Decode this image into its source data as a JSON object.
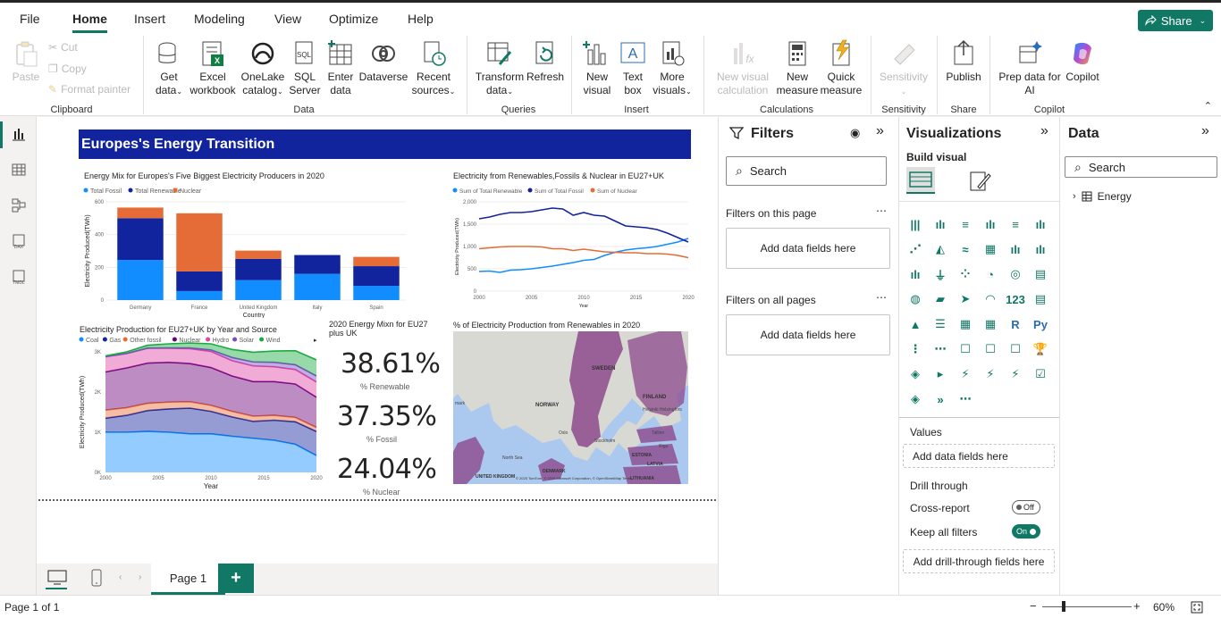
{
  "menu": [
    "File",
    "Home",
    "Insert",
    "Modeling",
    "View",
    "Optimize",
    "Help"
  ],
  "share_label": "Share",
  "ribbon": {
    "clipboard": {
      "paste": "Paste",
      "cut": "Cut",
      "copy": "Copy",
      "format_painter": "Format painter",
      "group": "Clipboard"
    },
    "data": {
      "get_data": "Get data",
      "excel": "Excel workbook",
      "onelake": "OneLake catalog",
      "sql": "SQL Server",
      "enter_data": "Enter data",
      "dataverse": "Dataverse",
      "recent": "Recent sources",
      "group": "Data"
    },
    "queries": {
      "transform": "Transform data",
      "refresh": "Refresh",
      "group": "Queries"
    },
    "insert": {
      "new_visual": "New visual",
      "text_box": "Text box",
      "more_visuals": "More visuals",
      "group": "Insert"
    },
    "calculations": {
      "new_visual_calc": "New visual calculation",
      "new_measure": "New measure",
      "quick_measure": "Quick measure",
      "group": "Calculations"
    },
    "sensitivity": {
      "label": "Sensitivity",
      "group": "Sensitivity"
    },
    "share": {
      "publish": "Publish",
      "group": "Share"
    },
    "copilot": {
      "prep": "Prep data for AI",
      "copilot": "Copilot",
      "group": "Copilot"
    }
  },
  "report": {
    "title": "Europes's Energy Transition",
    "colors": {
      "fossil": "#118dff",
      "renewable": "#12239e",
      "nuclear": "#e66c37",
      "banner": "#12239e"
    }
  },
  "chart_data": [
    {
      "type": "bar",
      "title": "Energy Mix for Europes's Five Biggest Electricity Producers in 2020",
      "xlabel": "Country",
      "ylabel": "Electricity Produced(TWh)",
      "ylim": [
        0,
        600
      ],
      "yticks": [
        "0",
        "200",
        "400",
        "600"
      ],
      "categories": [
        "Germany",
        "France",
        "United Kingdom",
        "Italy",
        "Spain"
      ],
      "series": [
        {
          "name": "Total Fossil",
          "values": [
            245,
            55,
            122,
            160,
            87
          ]
        },
        {
          "name": "Total Renewable",
          "values": [
            255,
            120,
            130,
            115,
            120
          ]
        },
        {
          "name": "Nuclear",
          "values": [
            65,
            355,
            50,
            0,
            57
          ]
        }
      ]
    },
    {
      "type": "line",
      "title": "Electricity from Renewables,Fossils & Nuclear in EU27+UK",
      "xlabel": "Year",
      "ylabel": "Electricity Produced(TWh)",
      "ylim": [
        0,
        2000
      ],
      "yticks": [
        "0",
        "500",
        "1,000",
        "1,500",
        "2,000"
      ],
      "xticks": [
        "2000",
        "2005",
        "2010",
        "2015",
        "2020"
      ],
      "x": [
        2000,
        2001,
        2002,
        2003,
        2004,
        2005,
        2006,
        2007,
        2008,
        2009,
        2010,
        2011,
        2012,
        2013,
        2014,
        2015,
        2016,
        2017,
        2018,
        2019,
        2020
      ],
      "series": [
        {
          "name": "Sum of Total Renewable",
          "values": [
            440,
            450,
            420,
            470,
            480,
            500,
            530,
            560,
            600,
            640,
            690,
            710,
            800,
            870,
            920,
            950,
            970,
            1000,
            1050,
            1100,
            1180
          ]
        },
        {
          "name": "Sum of Total Fossil",
          "values": [
            1620,
            1660,
            1720,
            1760,
            1760,
            1780,
            1820,
            1860,
            1840,
            1700,
            1760,
            1700,
            1680,
            1570,
            1460,
            1440,
            1420,
            1380,
            1300,
            1200,
            1100
          ]
        },
        {
          "name": "Sum of Nuclear",
          "values": [
            950,
            970,
            990,
            1000,
            1000,
            1000,
            990,
            950,
            950,
            910,
            940,
            910,
            880,
            870,
            860,
            860,
            840,
            840,
            830,
            800,
            750
          ]
        }
      ]
    },
    {
      "type": "area",
      "title": "Electricity Production for EU27+UK by Year and Source",
      "xlabel": "Year",
      "ylabel": "Electricity Produced(TWh)",
      "ylim": [
        0,
        3000
      ],
      "yticks": [
        "0K",
        "1K",
        "2K",
        "3K"
      ],
      "xticks": [
        "2000",
        "2005",
        "2010",
        "2015",
        "2020"
      ],
      "x": [
        2000,
        2002,
        2004,
        2006,
        2008,
        2010,
        2012,
        2014,
        2016,
        2018,
        2020
      ],
      "series": [
        {
          "name": "Coal",
          "values": [
            1000,
            1000,
            1020,
            1000,
            960,
            960,
            900,
            850,
            800,
            700,
            420
          ]
        },
        {
          "name": "Gas",
          "values": [
            350,
            420,
            520,
            580,
            640,
            560,
            480,
            420,
            500,
            560,
            600
          ]
        },
        {
          "name": "Other fossil",
          "values": [
            200,
            190,
            180,
            170,
            160,
            150,
            140,
            130,
            120,
            110,
            100
          ]
        },
        {
          "name": "Nuclear",
          "values": [
            950,
            990,
            1000,
            990,
            950,
            940,
            880,
            860,
            840,
            830,
            750
          ]
        },
        {
          "name": "Hydro",
          "values": [
            380,
            360,
            370,
            350,
            370,
            400,
            380,
            390,
            370,
            360,
            380
          ]
        },
        {
          "name": "Solar",
          "values": [
            0,
            0,
            5,
            10,
            20,
            40,
            80,
            100,
            110,
            120,
            150
          ]
        },
        {
          "name": "Wind",
          "values": [
            20,
            40,
            70,
            100,
            120,
            150,
            200,
            240,
            280,
            350,
            400
          ]
        }
      ]
    }
  ],
  "area_legend_colors": [
    "#118dff",
    "#12239e",
    "#e66c37",
    "#6b007b",
    "#e044a7",
    "#744ec2",
    "#1aab40"
  ],
  "cards": [
    {
      "value": "38.61%",
      "label": "% Renewable"
    },
    {
      "value": "37.35%",
      "label": "% Fossil"
    },
    {
      "value": "24.04%",
      "label": "% Nuclear"
    }
  ],
  "cards_title": "2020 Energy Mixn for EU27 plus UK",
  "map": {
    "title": "% of Electricity Production from Renewables in 2020",
    "labels": [
      "SWEDEN",
      "FINLAND",
      "NORWAY",
      "Helsinki Helsingfors",
      "Oslo",
      "Stockholm",
      "ESTONIA",
      "Tallinn",
      "North Sea",
      "DENMARK",
      "LATVIA",
      "LITHUANIA",
      "UNITED KINGDOM",
      "Riga",
      "mark"
    ],
    "copyright": "© 2025 TomTom, © 2025 Microsoft Corporation, © OpenStreetMap Terms"
  },
  "filters": {
    "title": "Filters",
    "search_placeholder": "Search",
    "on_page": "Filters on this page",
    "on_all": "Filters on all pages",
    "add_here": "Add data fields here"
  },
  "viz": {
    "title": "Visualizations",
    "build": "Build visual",
    "values": "Values",
    "values_add": "Add data fields here",
    "drill": "Drill through",
    "cross_report": "Cross-report",
    "cross_state": "Off",
    "keep_filters": "Keep all filters",
    "keep_state": "On",
    "drill_add": "Add drill-through fields here"
  },
  "datapane": {
    "title": "Data",
    "search_placeholder": "Search",
    "table": "Energy"
  },
  "tabs": {
    "page1": "Page 1"
  },
  "status": {
    "page": "Page 1 of 1",
    "zoom": "60%"
  }
}
